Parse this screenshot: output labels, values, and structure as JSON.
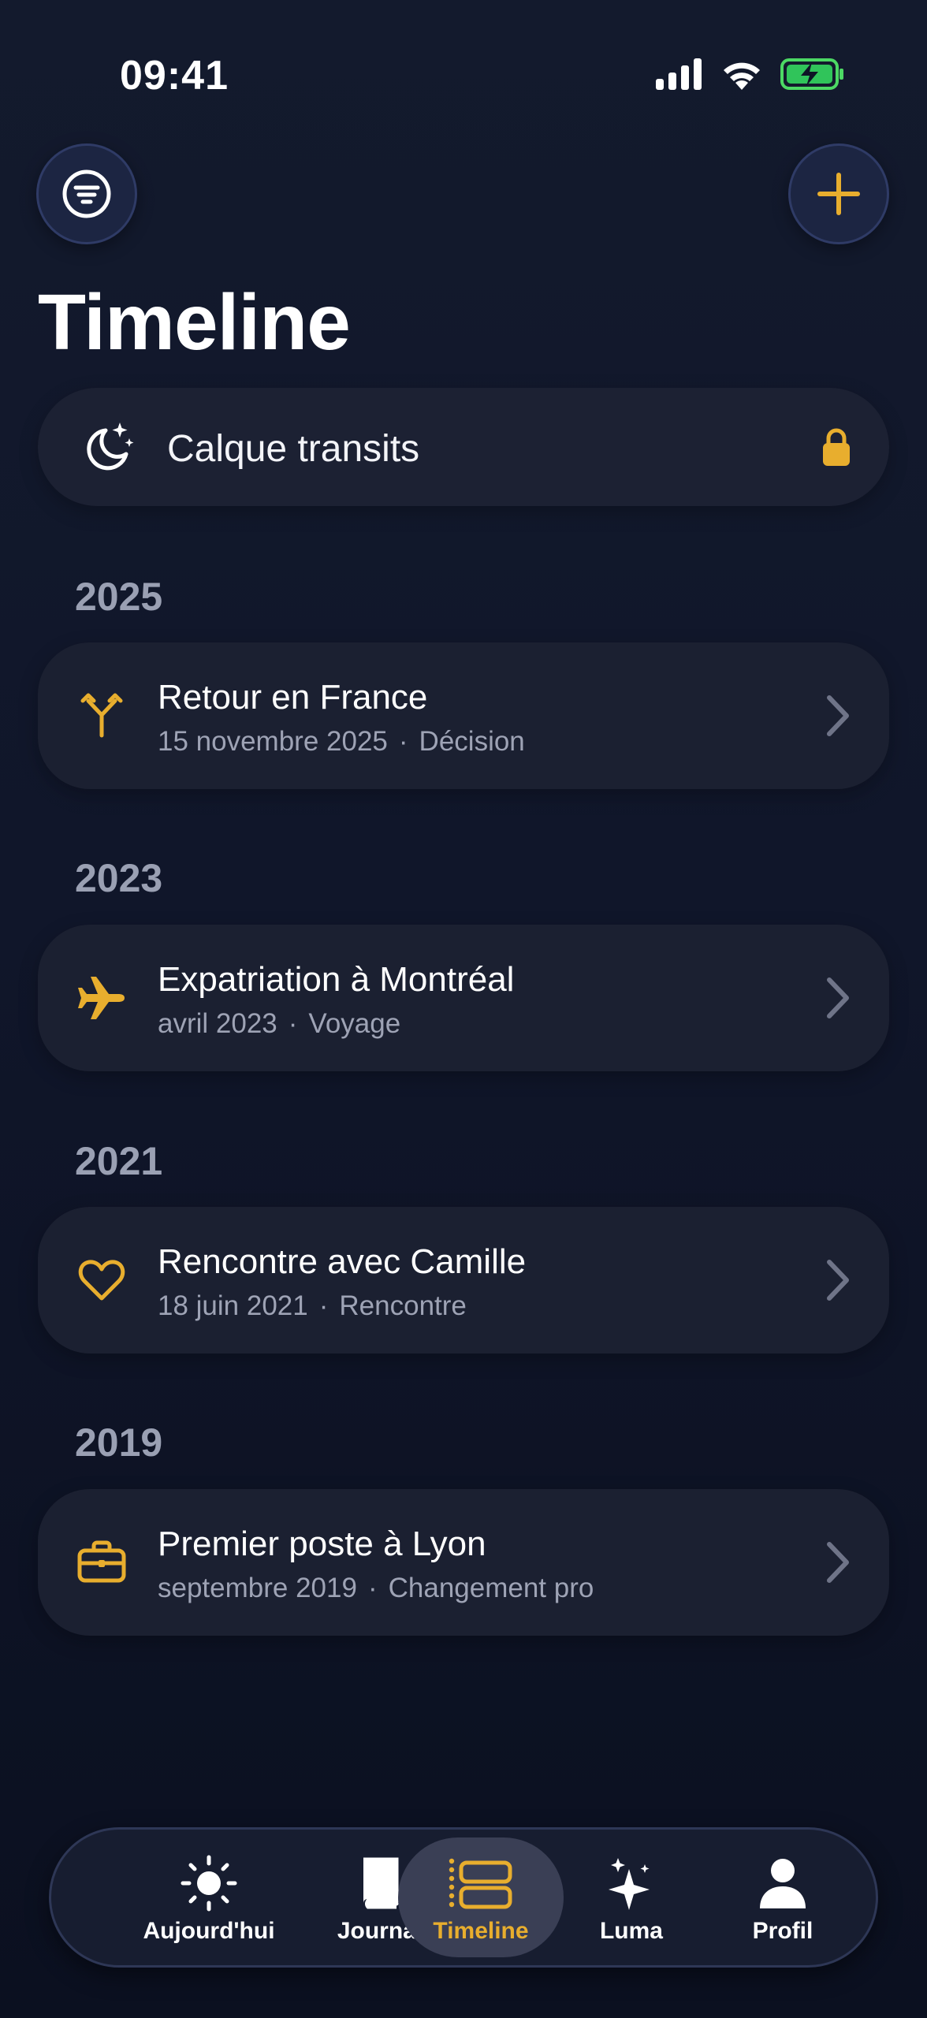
{
  "status_bar": {
    "time": "09:41"
  },
  "header": {
    "title": "Timeline",
    "filter_icon": "filter-lines-icon",
    "add_icon": "plus-icon"
  },
  "transits": {
    "label": "Calque transits",
    "icon": "moon-stars-icon",
    "lock_icon": "lock-icon"
  },
  "sections": [
    {
      "year": "2025",
      "event": {
        "title": "Retour en France",
        "date": "15 novembre 2025",
        "category": "Décision",
        "icon": "fork-icon"
      }
    },
    {
      "year": "2023",
      "event": {
        "title": "Expatriation à Montréal",
        "date": "avril 2023",
        "category": "Voyage",
        "icon": "airplane-icon"
      }
    },
    {
      "year": "2021",
      "event": {
        "title": "Rencontre avec Camille",
        "date": "18 juin 2021",
        "category": "Rencontre",
        "icon": "heart-icon"
      }
    },
    {
      "year": "2019",
      "event": {
        "title": "Premier poste à Lyon",
        "date": "septembre 2019",
        "category": "Changement pro",
        "icon": "briefcase-icon"
      }
    }
  ],
  "tabbar": {
    "tabs": [
      {
        "label": "Aujourd'hui",
        "icon": "sun-icon",
        "active": false
      },
      {
        "label": "Journal",
        "icon": "book-icon",
        "active": false
      },
      {
        "label": "Timeline",
        "icon": "timeline-icon",
        "active": true
      },
      {
        "label": "Luma",
        "icon": "sparkles-icon",
        "active": false
      },
      {
        "label": "Profil",
        "icon": "person-icon",
        "active": false
      }
    ]
  },
  "colors": {
    "accent": "#e8ae2e",
    "background": "#11172b",
    "card": "#1b2031",
    "muted_text": "#9ea3b5"
  }
}
